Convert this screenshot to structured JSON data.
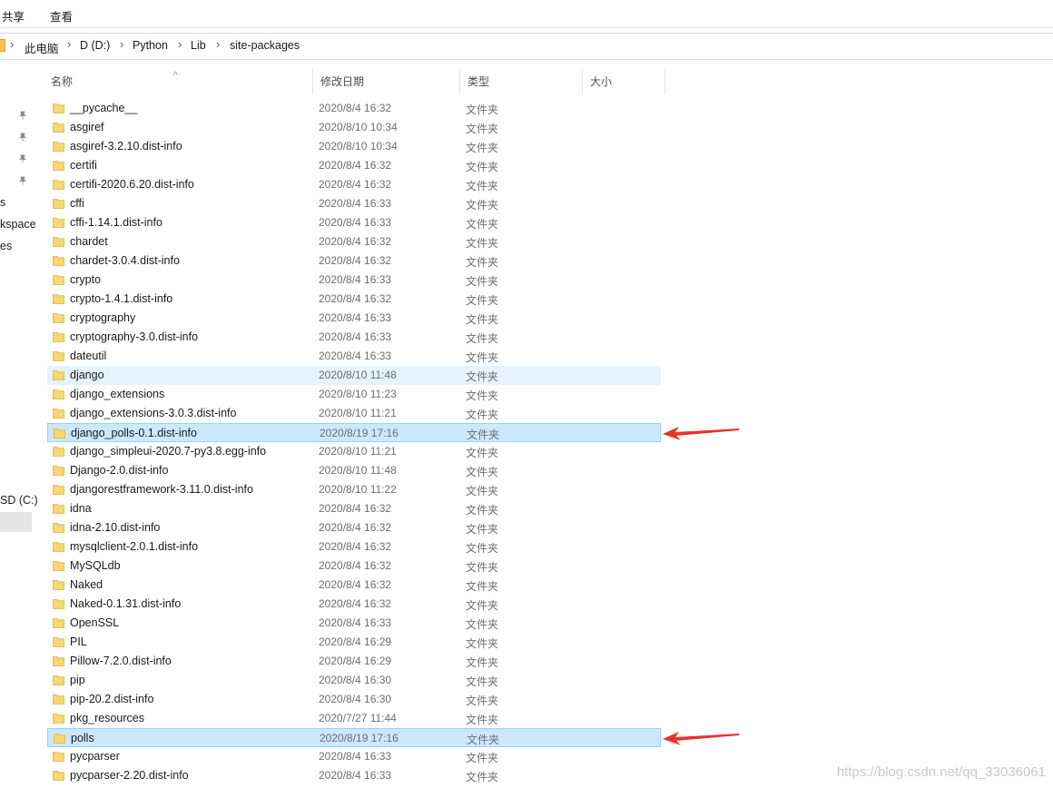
{
  "ribbon": {
    "tabs": [
      "共享",
      "查看"
    ]
  },
  "address": {
    "crumbs": [
      "此电脑",
      "D (D:)",
      "Python",
      "Lib",
      "site-packages"
    ]
  },
  "nav": {
    "items": [
      "s",
      "kspace",
      "es",
      "SD (C:)"
    ]
  },
  "columns": {
    "name": "名称",
    "date": "修改日期",
    "type": "类型",
    "size": "大小"
  },
  "rows": [
    {
      "name": "__pycache__",
      "date": "2020/8/4 16:32",
      "type": "文件夹"
    },
    {
      "name": "asgiref",
      "date": "2020/8/10 10:34",
      "type": "文件夹"
    },
    {
      "name": "asgiref-3.2.10.dist-info",
      "date": "2020/8/10 10:34",
      "type": "文件夹"
    },
    {
      "name": "certifi",
      "date": "2020/8/4 16:32",
      "type": "文件夹"
    },
    {
      "name": "certifi-2020.6.20.dist-info",
      "date": "2020/8/4 16:32",
      "type": "文件夹"
    },
    {
      "name": "cffi",
      "date": "2020/8/4 16:33",
      "type": "文件夹"
    },
    {
      "name": "cffi-1.14.1.dist-info",
      "date": "2020/8/4 16:33",
      "type": "文件夹"
    },
    {
      "name": "chardet",
      "date": "2020/8/4 16:32",
      "type": "文件夹"
    },
    {
      "name": "chardet-3.0.4.dist-info",
      "date": "2020/8/4 16:32",
      "type": "文件夹"
    },
    {
      "name": "crypto",
      "date": "2020/8/4 16:33",
      "type": "文件夹"
    },
    {
      "name": "crypto-1.4.1.dist-info",
      "date": "2020/8/4 16:32",
      "type": "文件夹"
    },
    {
      "name": "cryptography",
      "date": "2020/8/4 16:33",
      "type": "文件夹"
    },
    {
      "name": "cryptography-3.0.dist-info",
      "date": "2020/8/4 16:33",
      "type": "文件夹"
    },
    {
      "name": "dateutil",
      "date": "2020/8/4 16:33",
      "type": "文件夹"
    },
    {
      "name": "django",
      "date": "2020/8/10 11:48",
      "type": "文件夹",
      "state": "hover"
    },
    {
      "name": "django_extensions",
      "date": "2020/8/10 11:23",
      "type": "文件夹"
    },
    {
      "name": "django_extensions-3.0.3.dist-info",
      "date": "2020/8/10 11:21",
      "type": "文件夹"
    },
    {
      "name": "django_polls-0.1.dist-info",
      "date": "2020/8/19 17:16",
      "type": "文件夹",
      "state": "selected",
      "arrow": true
    },
    {
      "name": "django_simpleui-2020.7-py3.8.egg-info",
      "date": "2020/8/10 11:21",
      "type": "文件夹"
    },
    {
      "name": "Django-2.0.dist-info",
      "date": "2020/8/10 11:48",
      "type": "文件夹"
    },
    {
      "name": "djangorestframework-3.11.0.dist-info",
      "date": "2020/8/10 11:22",
      "type": "文件夹"
    },
    {
      "name": "idna",
      "date": "2020/8/4 16:32",
      "type": "文件夹"
    },
    {
      "name": "idna-2.10.dist-info",
      "date": "2020/8/4 16:32",
      "type": "文件夹"
    },
    {
      "name": "mysqlclient-2.0.1.dist-info",
      "date": "2020/8/4 16:32",
      "type": "文件夹"
    },
    {
      "name": "MySQLdb",
      "date": "2020/8/4 16:32",
      "type": "文件夹"
    },
    {
      "name": "Naked",
      "date": "2020/8/4 16:32",
      "type": "文件夹"
    },
    {
      "name": "Naked-0.1.31.dist-info",
      "date": "2020/8/4 16:32",
      "type": "文件夹"
    },
    {
      "name": "OpenSSL",
      "date": "2020/8/4 16:33",
      "type": "文件夹"
    },
    {
      "name": "PIL",
      "date": "2020/8/4 16:29",
      "type": "文件夹"
    },
    {
      "name": "Pillow-7.2.0.dist-info",
      "date": "2020/8/4 16:29",
      "type": "文件夹"
    },
    {
      "name": "pip",
      "date": "2020/8/4 16:30",
      "type": "文件夹"
    },
    {
      "name": "pip-20.2.dist-info",
      "date": "2020/8/4 16:30",
      "type": "文件夹"
    },
    {
      "name": "pkg_resources",
      "date": "2020/7/27 11:44",
      "type": "文件夹"
    },
    {
      "name": "polls",
      "date": "2020/8/19 17:16",
      "type": "文件夹",
      "state": "selected",
      "arrow": true
    },
    {
      "name": "pycparser",
      "date": "2020/8/4 16:33",
      "type": "文件夹"
    },
    {
      "name": "pycparser-2.20.dist-info",
      "date": "2020/8/4 16:33",
      "type": "文件夹"
    }
  ],
  "colors": {
    "folder": "#f8d775",
    "folder_edge": "#e0b13c",
    "selected_bg": "#cce8ff",
    "hover_bg": "#e5f3ff",
    "arrow": "#e8332c"
  },
  "watermark": "https://blog.csdn.net/qq_33036061"
}
